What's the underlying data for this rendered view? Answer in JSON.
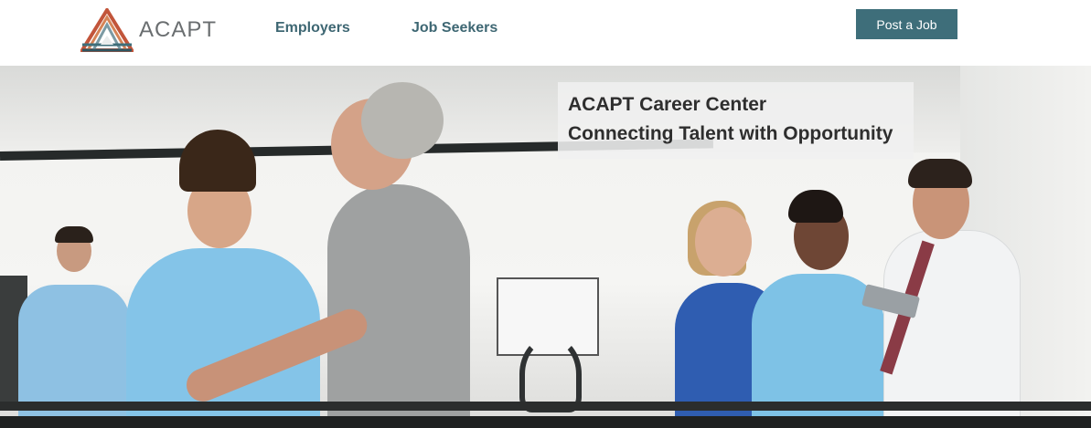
{
  "header": {
    "logo_text": "ACAPT",
    "nav": [
      {
        "label": "Employers"
      },
      {
        "label": "Job Seekers"
      }
    ],
    "post_job_label": "Post a Job"
  },
  "hero": {
    "line1": "ACAPT Career Center",
    "line2": "Connecting Talent with Opportunity"
  },
  "colors": {
    "nav_text": "#3e6773",
    "button_bg": "#3e6e7a",
    "logo_text": "#6a6e70"
  }
}
